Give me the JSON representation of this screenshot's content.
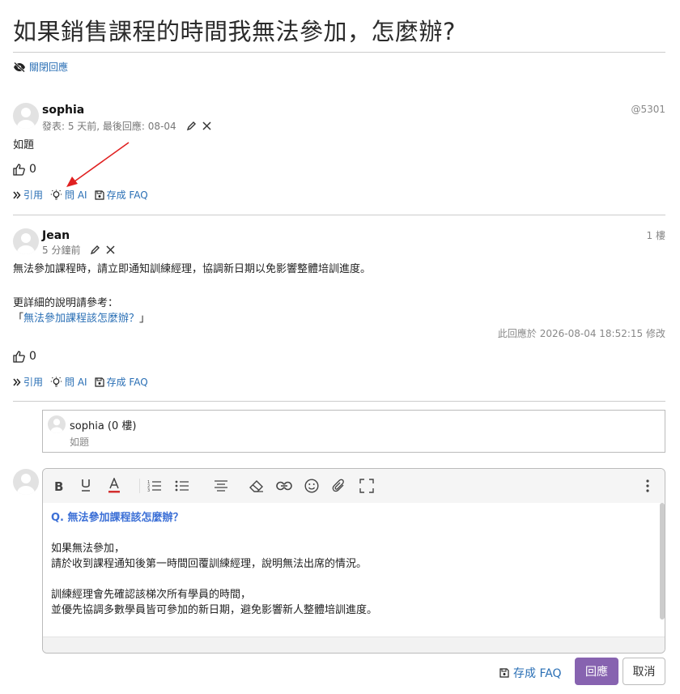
{
  "page": {
    "title": "如果銷售課程的時間我無法參加，怎麼辦?",
    "close_reply_label": "關閉回應"
  },
  "posts": [
    {
      "username": "sophia",
      "meta": "發表: 5 天前, 最後回應: 08-04",
      "floor": "@5301",
      "body": "如題",
      "likes": "0",
      "actions": {
        "quote": "引用",
        "ask_ai": "問 AI",
        "save_faq": "存成 FAQ"
      }
    },
    {
      "username": "Jean",
      "meta": "5 分鐘前",
      "floor": "1 樓",
      "body_line1": "無法參加課程時，請立即通知訓練經理，協調新日期以免影響整體培訓進度。",
      "body_line2": "更詳細的說明請參考：",
      "link_open": "「",
      "link_text": "無法參加課程該怎麼辦？",
      "link_close": "」",
      "edit_note": "此回應於 2026-08-04 18:52:15 修改",
      "likes": "0",
      "actions": {
        "quote": "引用",
        "ask_ai": "問 AI",
        "save_faq": "存成 FAQ"
      }
    }
  ],
  "quote_box": {
    "title": "sophia (0 樓)",
    "body": "如題"
  },
  "editor": {
    "toolbar": [
      "bold-icon",
      "underline-icon",
      "font-color-icon",
      "ordered-list-icon",
      "bullet-list-icon",
      "align-center-icon",
      "eraser-icon",
      "link-icon",
      "emoji-icon",
      "attachment-icon",
      "fullscreen-icon",
      "more-icon"
    ],
    "font_color": "#d32f2f",
    "content": {
      "question": "Q. 無法參加課程該怎麼辦？",
      "p1_line1": "如果無法參加，",
      "p1_line2": "請於收到課程通知後第一時間回覆訓練經理，說明無法出席的情況。",
      "p2_line1": "訓練經理會先確認該梯次所有學員的時間，",
      "p2_line2": "並優先協調多數學員皆可參加的新日期，避免影響新人整體培訓進度。"
    }
  },
  "footer": {
    "save_faq": "存成 FAQ",
    "reply": "回應",
    "cancel": "取消"
  },
  "colors": {
    "link": "#2a6fb5",
    "reply_button": "#8763b0",
    "annotation_arrow": "#e02020"
  }
}
